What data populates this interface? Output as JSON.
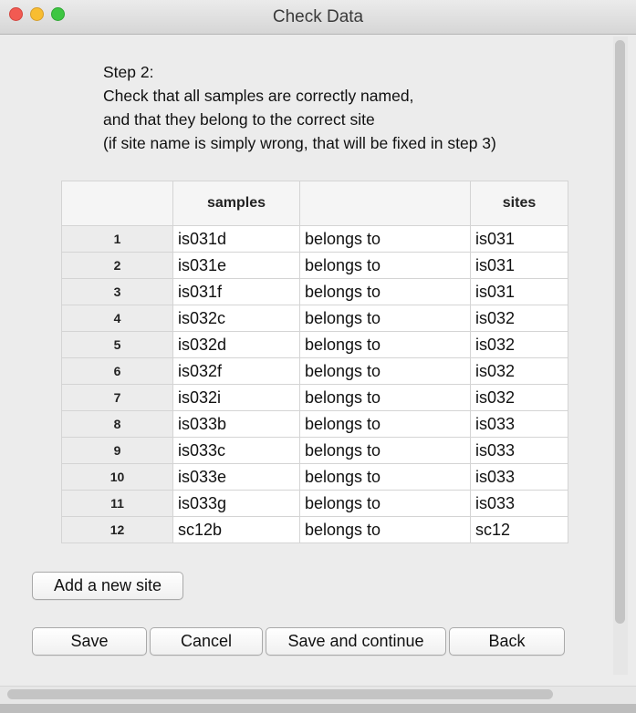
{
  "window": {
    "title": "Check Data",
    "buttons": [
      "close",
      "minimize",
      "zoom"
    ]
  },
  "instructions": [
    "Step 2:",
    "Check that all samples are correctly named,",
    "and that they belong to the correct site",
    "(if site name is simply wrong, that will be fixed in step 3)"
  ],
  "table": {
    "headers": [
      "",
      "samples",
      "",
      "sites"
    ],
    "rows": [
      {
        "num": "1",
        "sample": "is031d",
        "relation": "belongs to",
        "site": "is031"
      },
      {
        "num": "2",
        "sample": "is031e",
        "relation": "belongs to",
        "site": "is031"
      },
      {
        "num": "3",
        "sample": "is031f",
        "relation": "belongs to",
        "site": "is031"
      },
      {
        "num": "4",
        "sample": "is032c",
        "relation": "belongs to",
        "site": "is032"
      },
      {
        "num": "5",
        "sample": "is032d",
        "relation": "belongs to",
        "site": "is032"
      },
      {
        "num": "6",
        "sample": "is032f",
        "relation": "belongs to",
        "site": "is032"
      },
      {
        "num": "7",
        "sample": "is032i",
        "relation": "belongs to",
        "site": "is032"
      },
      {
        "num": "8",
        "sample": "is033b",
        "relation": "belongs to",
        "site": "is033"
      },
      {
        "num": "9",
        "sample": "is033c",
        "relation": "belongs to",
        "site": "is033"
      },
      {
        "num": "10",
        "sample": "is033e",
        "relation": "belongs to",
        "site": "is033"
      },
      {
        "num": "11",
        "sample": "is033g",
        "relation": "belongs to",
        "site": "is033"
      },
      {
        "num": "12",
        "sample": "sc12b",
        "relation": "belongs to",
        "site": "sc12"
      }
    ]
  },
  "buttons": {
    "add_site": "Add a new site",
    "save": "Save",
    "cancel": "Cancel",
    "save_continue": "Save and continue",
    "back": "Back"
  },
  "colors": {
    "close": "#f25a52",
    "minimize": "#f8bd31",
    "zoom": "#3ec642",
    "window_bg": "#ececec"
  }
}
